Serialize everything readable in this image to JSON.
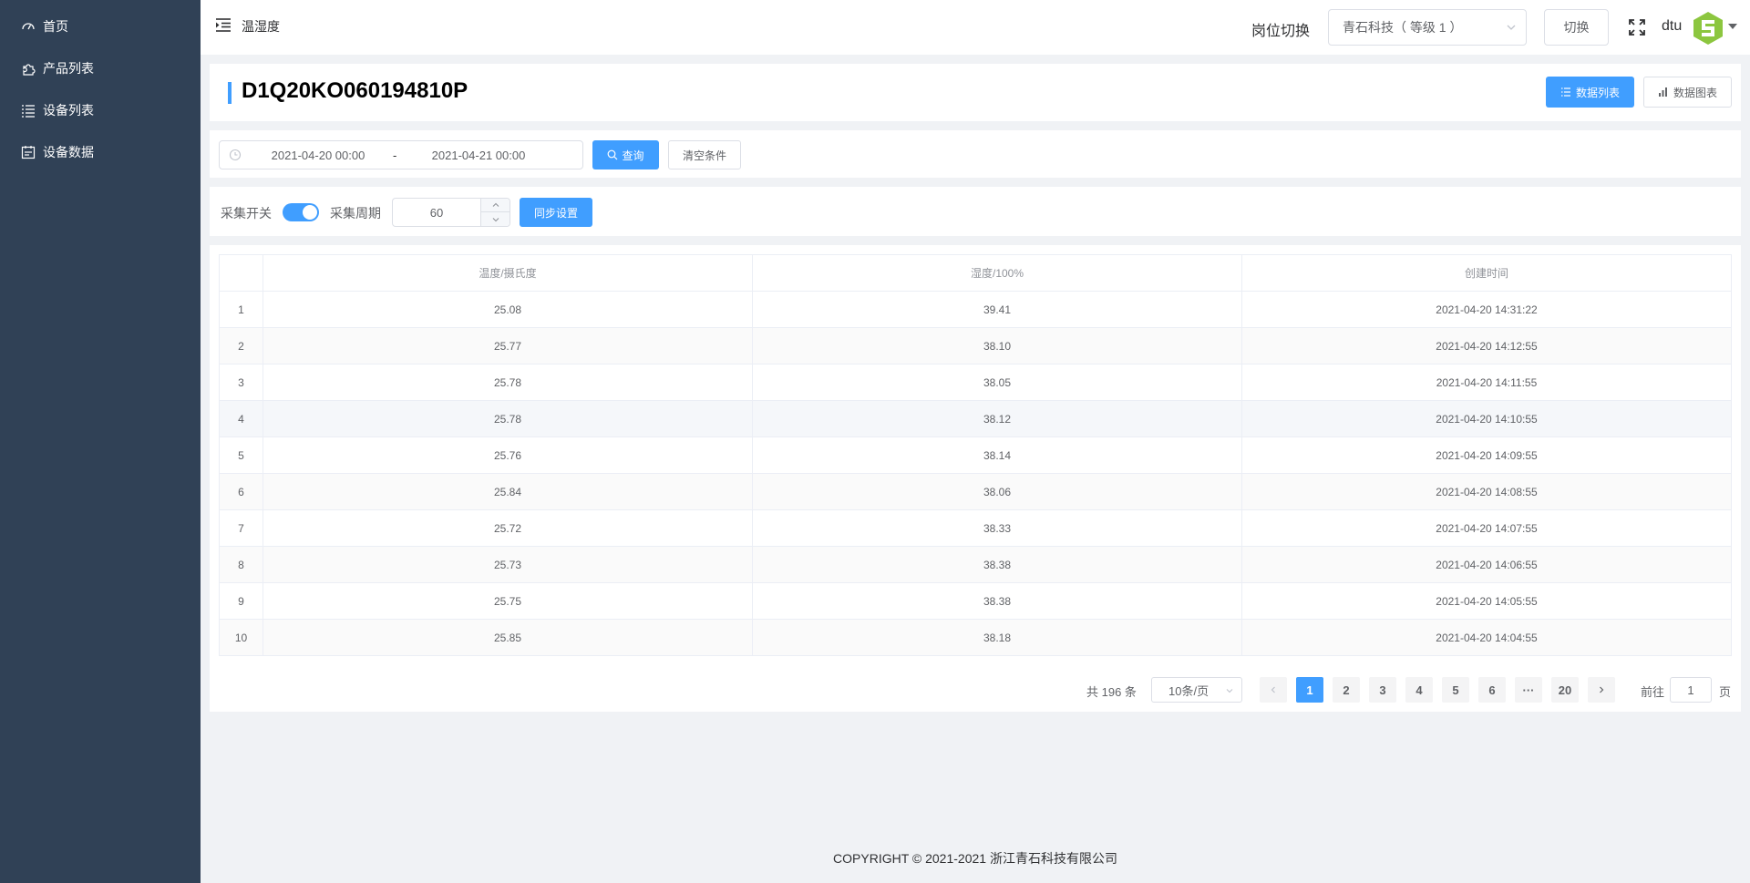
{
  "sidebar": {
    "items": [
      {
        "label": "首页",
        "icon": "dashboard-icon"
      },
      {
        "label": "产品列表",
        "icon": "puzzle-icon"
      },
      {
        "label": "设备列表",
        "icon": "list-icon"
      },
      {
        "label": "设备数据",
        "icon": "data-icon"
      }
    ]
  },
  "topbar": {
    "breadcrumb": "温湿度",
    "role_label": "岗位切换",
    "role_selected": "青石科技（ 等级 1 ）",
    "switch_label": "切换",
    "user": "dtu"
  },
  "title_card": {
    "device_id": "D1Q20KO060194810P",
    "data_list_label": "数据列表",
    "data_chart_label": "数据图表"
  },
  "query": {
    "start_date": "2021-04-20 00:00",
    "separator": "-",
    "end_date": "2021-04-21 00:00",
    "search_label": "查询",
    "clear_label": "清空条件"
  },
  "collect": {
    "switch_label": "采集开关",
    "switch_on": true,
    "period_label": "采集周期",
    "period_value": "60",
    "sync_label": "同步设置"
  },
  "table": {
    "headers": [
      "",
      "温度/摄氏度",
      "湿度/100%",
      "创建时间"
    ],
    "rows": [
      [
        "1",
        "25.08",
        "39.41",
        "2021-04-20 14:31:22"
      ],
      [
        "2",
        "25.77",
        "38.10",
        "2021-04-20 14:12:55"
      ],
      [
        "3",
        "25.78",
        "38.05",
        "2021-04-20 14:11:55"
      ],
      [
        "4",
        "25.78",
        "38.12",
        "2021-04-20 14:10:55"
      ],
      [
        "5",
        "25.76",
        "38.14",
        "2021-04-20 14:09:55"
      ],
      [
        "6",
        "25.84",
        "38.06",
        "2021-04-20 14:08:55"
      ],
      [
        "7",
        "25.72",
        "38.33",
        "2021-04-20 14:07:55"
      ],
      [
        "8",
        "25.73",
        "38.38",
        "2021-04-20 14:06:55"
      ],
      [
        "9",
        "25.75",
        "38.38",
        "2021-04-20 14:05:55"
      ],
      [
        "10",
        "25.85",
        "38.18",
        "2021-04-20 14:04:55"
      ]
    ]
  },
  "pagination": {
    "total": "共 196 条",
    "page_size": "10条/页",
    "pages": [
      "1",
      "2",
      "3",
      "4",
      "5",
      "6",
      "···",
      "20"
    ],
    "current": "1",
    "goto_label": "前往",
    "goto_value": "1",
    "page_suffix": "页"
  },
  "footer": "COPYRIGHT © 2021-2021 浙江青石科技有限公司",
  "colors": {
    "sidebar_bg": "#304156",
    "primary": "#409eff",
    "logo_green": "#8cc63f"
  }
}
